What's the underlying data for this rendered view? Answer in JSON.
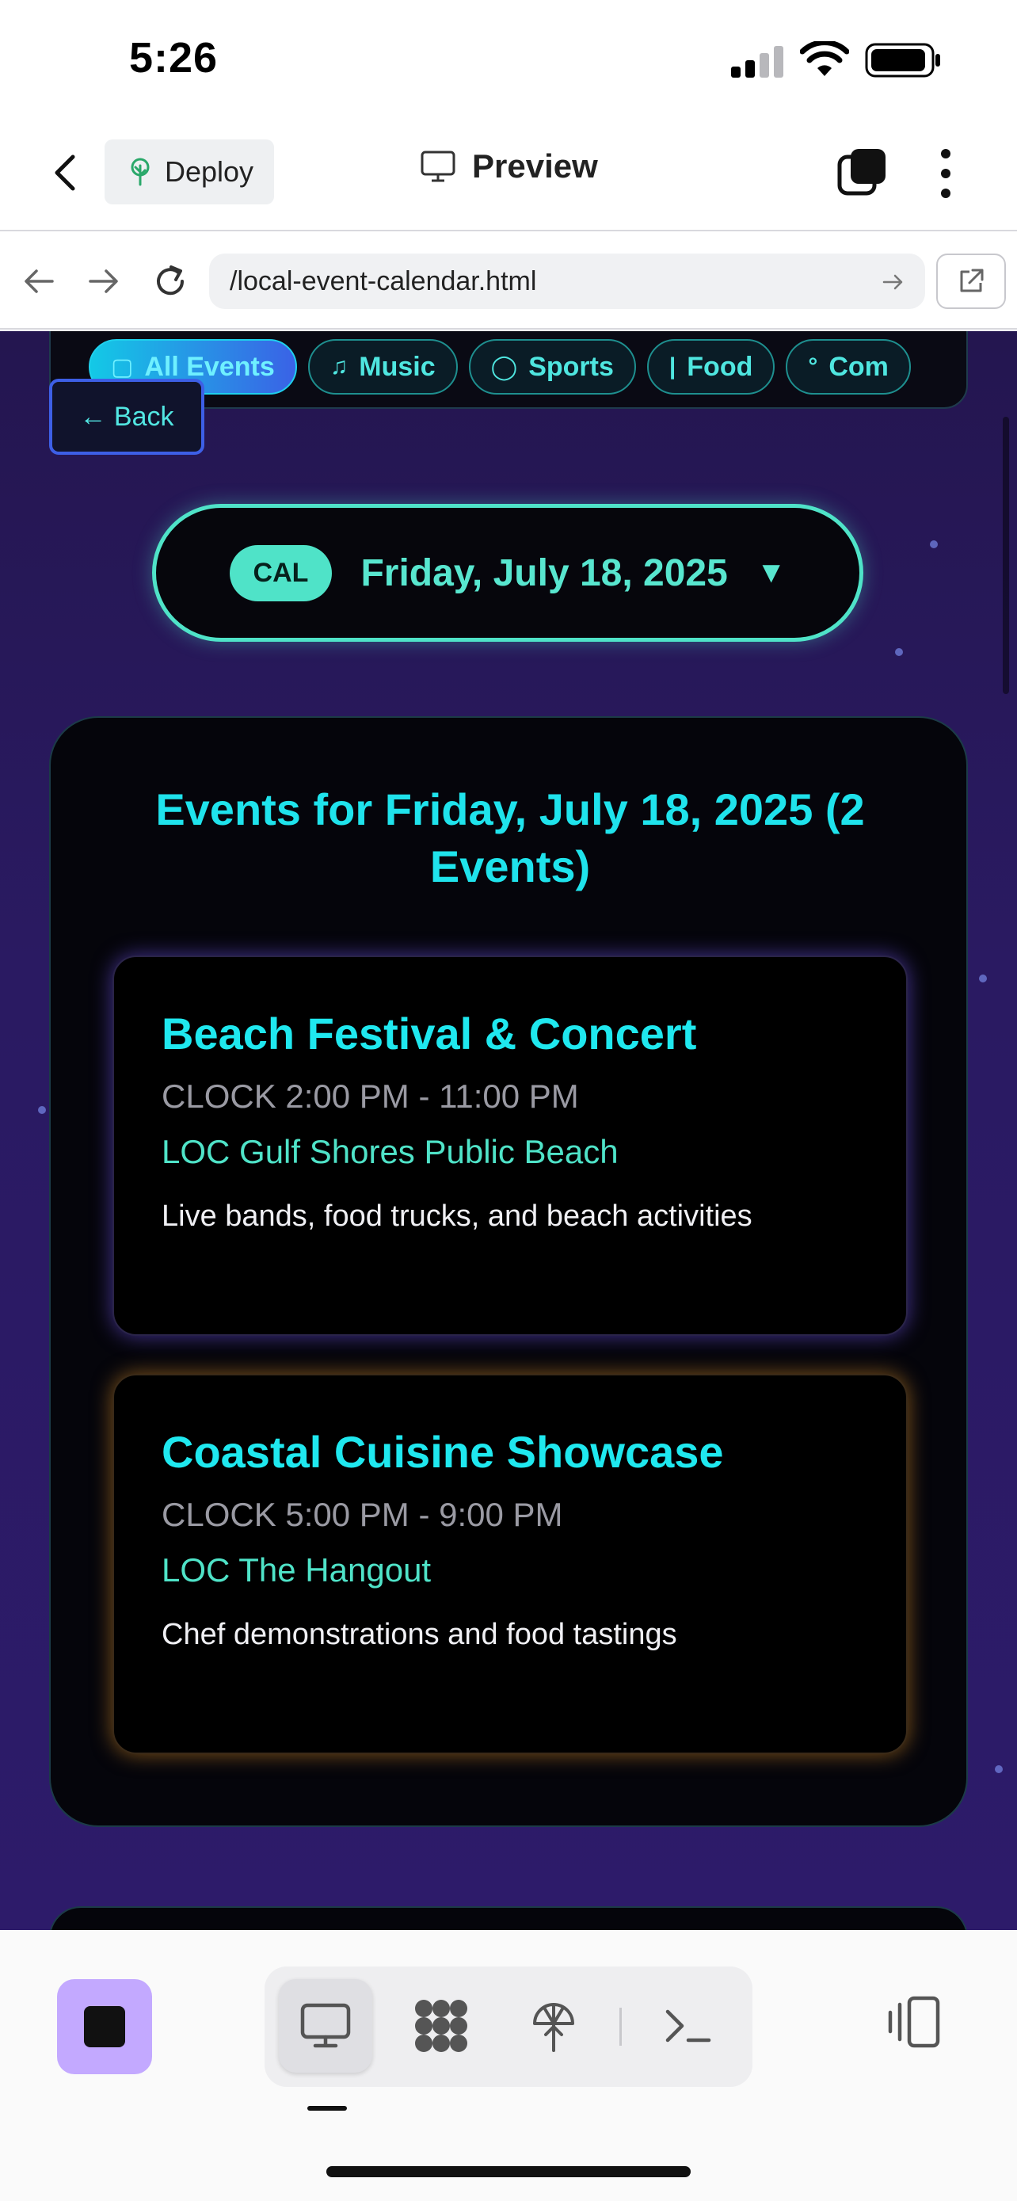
{
  "status_bar": {
    "time": "5:26"
  },
  "app_header": {
    "deploy_label": "Deploy",
    "preview_label": "Preview"
  },
  "browser": {
    "url": "/local-event-calendar.html"
  },
  "categories": [
    {
      "icon": "▢",
      "label": "All Events",
      "active": true
    },
    {
      "icon": "♫",
      "label": "Music"
    },
    {
      "icon": "◯",
      "label": "Sports"
    },
    {
      "icon": "|",
      "label": "Food"
    },
    {
      "icon": "°",
      "label": "Com"
    }
  ],
  "back_button": {
    "label": "← Back"
  },
  "date_picker": {
    "badge": "CAL",
    "date": "Friday, July 18, 2025",
    "caret": "▼"
  },
  "events_panel": {
    "heading": "Events for Friday, July 18, 2025 (2 Events)",
    "events": [
      {
        "title": "Beach Festival & Concert",
        "time": "CLOCK 2:00 PM - 11:00 PM",
        "location": "LOC Gulf Shores Public Beach",
        "description": "Live bands, food trucks, and beach activities",
        "glow": "#7a5aff"
      },
      {
        "title": "Coastal Cuisine Showcase",
        "time": "CLOCK 5:00 PM - 9:00 PM",
        "location": "LOC The Hangout",
        "description": "Chef demonstrations and food tastings",
        "glow": "#e6962a"
      }
    ]
  },
  "toolbar": {
    "icons": [
      "desktop-icon",
      "apps-grid-icon",
      "deploy-tree-icon",
      "terminal-icon"
    ],
    "active_tool": "desktop-icon",
    "device_icon": "device-switch-icon",
    "stop_color": "#c3a9ff"
  },
  "colors": {
    "accent_cyan": "#1fe3ec",
    "accent_teal": "#4fe3c8",
    "bg_purple": "#2a1a62"
  }
}
